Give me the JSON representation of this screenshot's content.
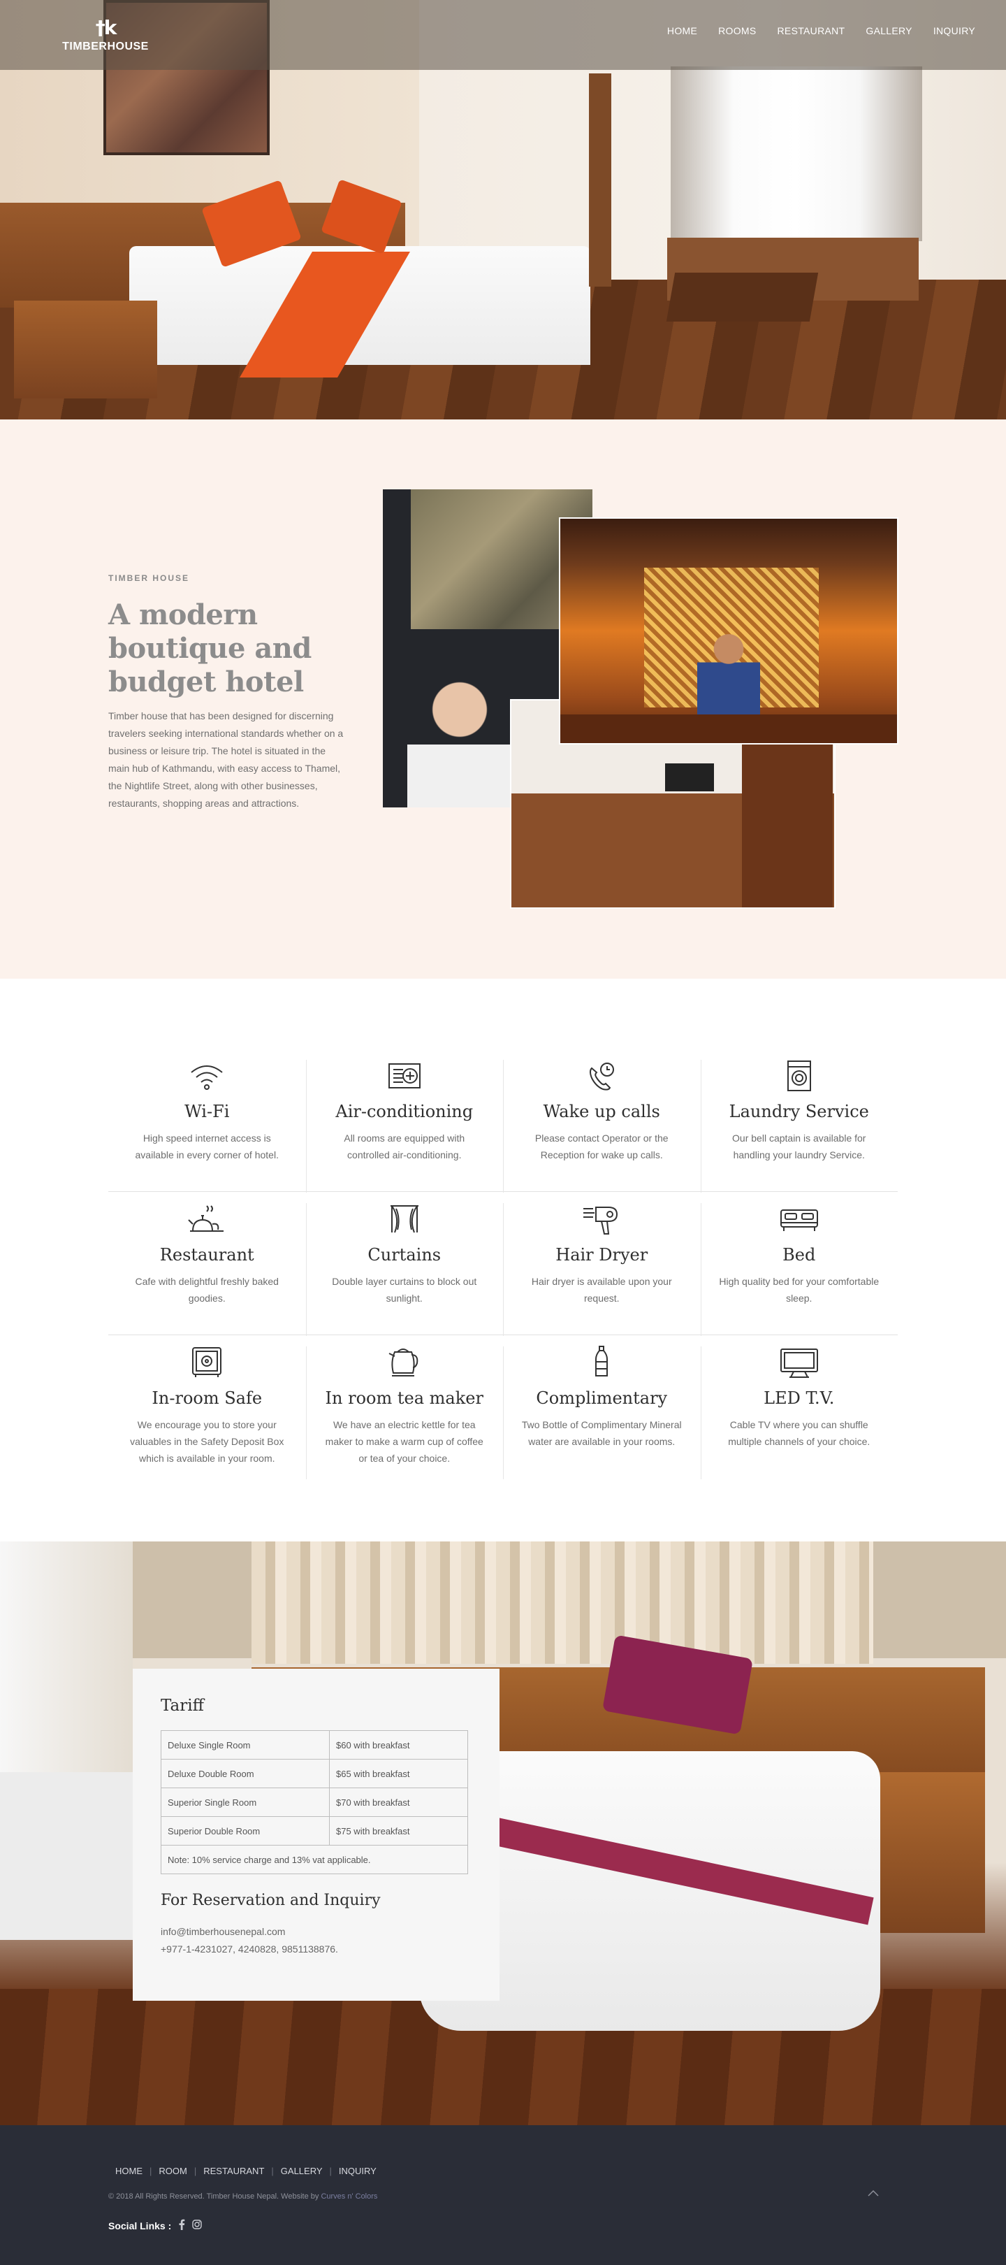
{
  "brand": {
    "name": "TIMBERHOUSE",
    "mark": "†k"
  },
  "nav": [
    {
      "label": "HOME"
    },
    {
      "label": "ROOMS"
    },
    {
      "label": "RESTAURANT"
    },
    {
      "label": "GALLERY"
    },
    {
      "label": "INQUIRY"
    }
  ],
  "about": {
    "eyebrow": "TIMBER HOUSE",
    "heading": "A modern boutique and budget hotel",
    "body": "Timber house that has been designed for discerning travelers seeking international standards whether on a business or leisure trip. The hotel is situated in the main hub of Kathmandu, with easy access to Thamel, the Nightlife Street, along with other businesses, restaurants, shopping areas and attractions."
  },
  "features": [
    {
      "icon": "wifi-icon",
      "title": "Wi-Fi",
      "desc": "High speed internet access is available in every corner of hotel."
    },
    {
      "icon": "air-conditioner-icon",
      "title": "Air-conditioning",
      "desc": "All rooms are equipped with controlled air-conditioning."
    },
    {
      "icon": "phone-clock-icon",
      "title": "Wake up calls",
      "desc": "Please contact Operator or the Reception for wake up calls."
    },
    {
      "icon": "washing-machine-icon",
      "title": "Laundry Service",
      "desc": "Our bell captain is available for handling your laundry Service."
    },
    {
      "icon": "teapot-icon",
      "title": "Restaurant",
      "desc": "Cafe with delightful freshly baked goodies."
    },
    {
      "icon": "curtains-icon",
      "title": "Curtains",
      "desc": "Double layer curtains to block out sunlight."
    },
    {
      "icon": "hair-dryer-icon",
      "title": "Hair Dryer",
      "desc": "Hair dryer is available upon your request."
    },
    {
      "icon": "bed-icon",
      "title": "Bed",
      "desc": "High quality bed for your comfortable sleep."
    },
    {
      "icon": "safe-icon",
      "title": "In-room Safe",
      "desc": "We encourage you to store your valuables in the Safety Deposit Box which is available in your room."
    },
    {
      "icon": "kettle-icon",
      "title": "In room tea maker",
      "desc": "We have an electric kettle for tea maker to make a warm cup of coffee or tea of your choice."
    },
    {
      "icon": "water-bottle-icon",
      "title": "Complimentary",
      "desc": "Two Bottle of Complimentary Mineral water are available in your rooms."
    },
    {
      "icon": "tv-icon",
      "title": "LED T.V.",
      "desc": "Cable TV where you can shuffle multiple channels of your choice."
    }
  ],
  "tariff": {
    "title": "Tariff",
    "rows": [
      {
        "room": "Deluxe Single Room",
        "price": "$60 with breakfast"
      },
      {
        "room": "Deluxe Double Room",
        "price": "$65 with breakfast"
      },
      {
        "room": "Superior Single Room",
        "price": "$70 with breakfast"
      },
      {
        "room": "Superior Double Room",
        "price": "$75 with breakfast"
      }
    ],
    "note": "Note: 10% service charge and 13% vat applicable.",
    "reservation_title": "For Reservation and Inquiry",
    "email": "info@timberhousenepal.com",
    "phone": "+977-1-4231027, 4240828, 9851138876."
  },
  "footer": {
    "nav": [
      {
        "label": "HOME"
      },
      {
        "label": "ROOM"
      },
      {
        "label": "RESTAURANT"
      },
      {
        "label": "GALLERY"
      },
      {
        "label": "INQUIRY"
      }
    ],
    "copyright": "© 2018 All Rights Reserved. Timber House Nepal. Website by",
    "credit": "Curves n' Colors",
    "social_label": "Social Links :",
    "social_icons": [
      "facebook-icon",
      "instagram-icon"
    ]
  }
}
